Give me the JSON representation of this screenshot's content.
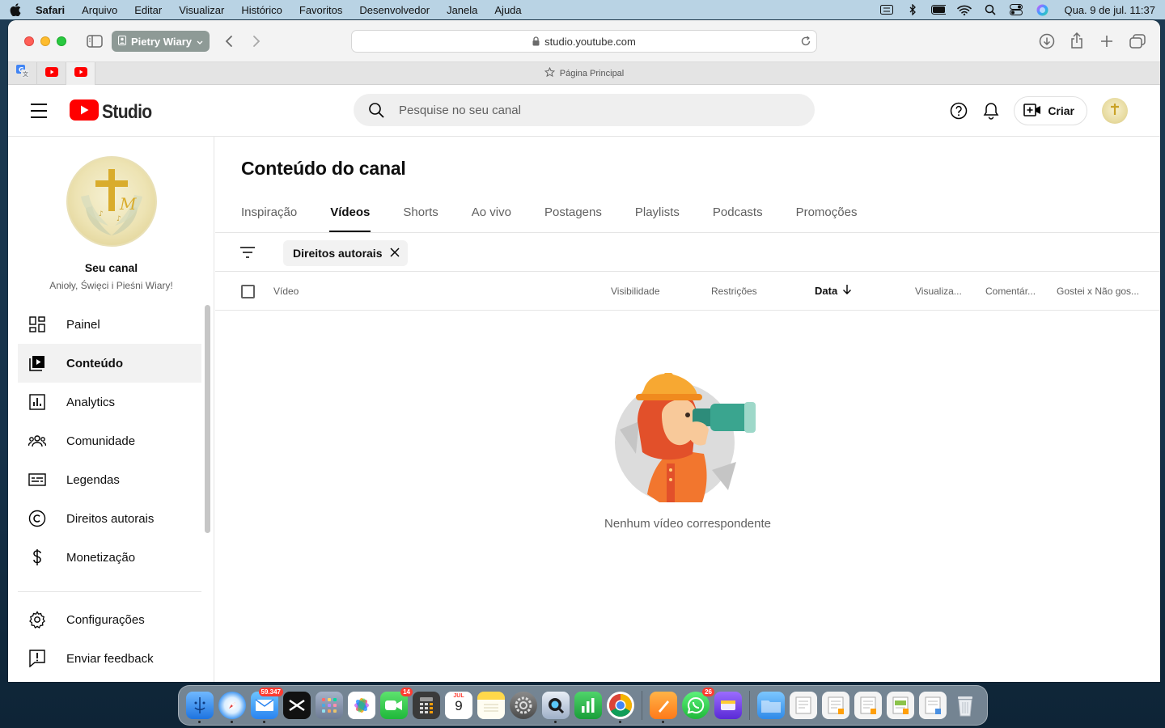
{
  "menubar": {
    "app": "Safari",
    "items": [
      "Arquivo",
      "Editar",
      "Visualizar",
      "Histórico",
      "Favoritos",
      "Desenvolvedor",
      "Janela",
      "Ajuda"
    ],
    "clock": "Qua. 9 de jul.  11:37"
  },
  "browser": {
    "profile": "Pietry Wiary",
    "url": "studio.youtube.com",
    "tab_title": "Página Principal"
  },
  "header": {
    "logo_text": "Studio",
    "search_placeholder": "Pesquise no seu canal",
    "create_label": "Criar"
  },
  "sidebar": {
    "your_channel": "Seu canal",
    "channel_name": "Anioły, Święci i Pieśni Wiary!",
    "items": [
      {
        "label": "Painel",
        "icon": "dashboard-icon"
      },
      {
        "label": "Conteúdo",
        "icon": "content-icon",
        "active": true
      },
      {
        "label": "Analytics",
        "icon": "analytics-icon"
      },
      {
        "label": "Comunidade",
        "icon": "community-icon"
      },
      {
        "label": "Legendas",
        "icon": "subtitles-icon"
      },
      {
        "label": "Direitos autorais",
        "icon": "copyright-icon"
      },
      {
        "label": "Monetização",
        "icon": "dollar-icon"
      }
    ],
    "bottom_items": [
      {
        "label": "Configurações",
        "icon": "gear-icon"
      },
      {
        "label": "Enviar feedback",
        "icon": "feedback-icon"
      }
    ]
  },
  "main": {
    "title": "Conteúdo do canal",
    "tabs": [
      {
        "label": "Inspiração"
      },
      {
        "label": "Vídeos",
        "active": true
      },
      {
        "label": "Shorts"
      },
      {
        "label": "Ao vivo"
      },
      {
        "label": "Postagens"
      },
      {
        "label": "Playlists"
      },
      {
        "label": "Podcasts"
      },
      {
        "label": "Promoções"
      }
    ],
    "filter_chip": "Direitos autorais",
    "columns": {
      "video": "Vídeo",
      "visibility": "Visibilidade",
      "restrictions": "Restrições",
      "date": "Data",
      "views": "Visualiza...",
      "comments": "Comentár...",
      "likes": "Gostei x Não gos..."
    },
    "empty_message": "Nenhum vídeo correspondente"
  },
  "dock": {
    "mail_badge": "59.347",
    "facetime_badge": "14",
    "calendar_month": "JUL",
    "calendar_day": "9",
    "whatsapp_badge": "26"
  },
  "colors": {
    "youtube_red": "#ff0000",
    "active_nav_bg": "#f2f2f2",
    "menubar_bg": "#b9d3e4"
  }
}
